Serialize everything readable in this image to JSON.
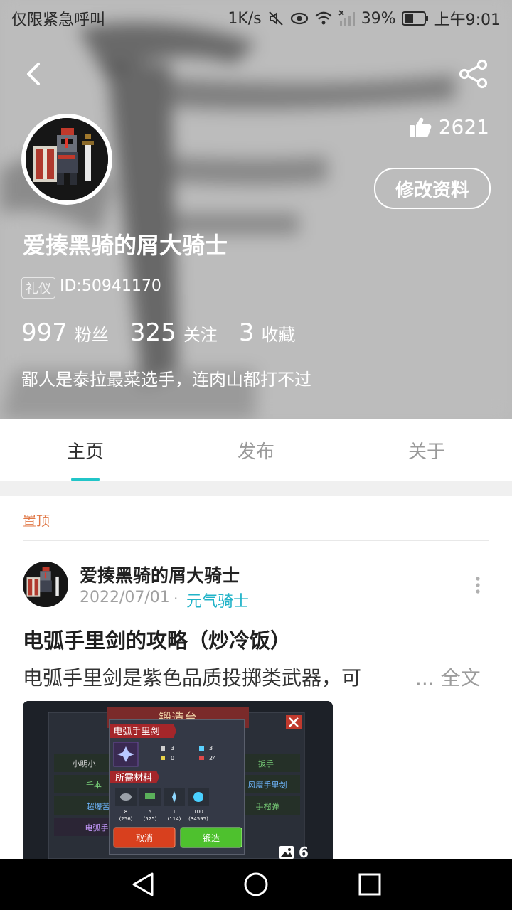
{
  "status_bar": {
    "left_text": "仅限紧急呼叫",
    "speed": "1K/s",
    "battery": "39%",
    "time": "上午9:01"
  },
  "profile": {
    "likes": "2621",
    "edit_label": "修改资料",
    "username": "爱揍黑骑的屑大骑士",
    "badge": "礼仪",
    "id": "ID:50941170",
    "stats": [
      {
        "num": "997",
        "label": "粉丝"
      },
      {
        "num": "325",
        "label": "关注"
      },
      {
        "num": "3",
        "label": "收藏"
      }
    ],
    "bio": "鄙人是泰拉最菜选手，连肉山都打不过"
  },
  "tabs": [
    "主页",
    "发布",
    "关于"
  ],
  "post": {
    "pinned": "置顶",
    "author": "爱揍黑骑的屑大骑士",
    "date": "2022/07/01",
    "dot": "·",
    "game": "元气骑士",
    "title": "电弧手里剑的攻略（炒冷饭）",
    "excerpt": "电弧手里剑是紫色品质投掷类武器，可",
    "read_more": "... 全文",
    "image_count": "6",
    "image": {
      "forge_title": "锻造台",
      "weapon_name": "电弧手里剑",
      "materials_title": "所需材料",
      "stat_values": [
        "3",
        "3",
        "0",
        "24"
      ],
      "materials": [
        {
          "count": "8",
          "total": "(256)"
        },
        {
          "count": "5",
          "total": "(525)"
        },
        {
          "count": "1",
          "total": "(114)"
        },
        {
          "count": "100",
          "total": "(34595)"
        }
      ],
      "cancel": "取消",
      "forge": "锻造",
      "list_left": [
        "小明小",
        "千本",
        "超爆苦",
        "电弧手"
      ],
      "list_right": [
        "扳手",
        "风魔手里剑",
        "手榴弹"
      ]
    }
  }
}
